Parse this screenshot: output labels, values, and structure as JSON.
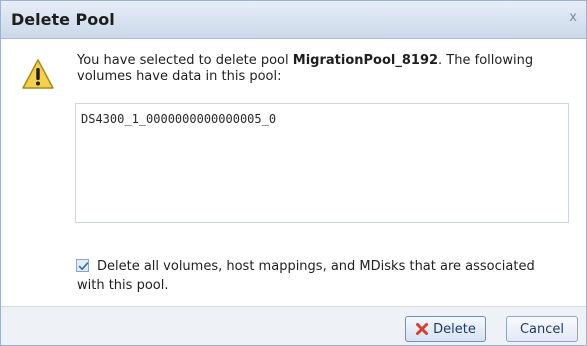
{
  "dialog": {
    "title": "Delete Pool",
    "close_glyph": "x"
  },
  "message": {
    "prefix": "You have selected to delete pool ",
    "pool_name": "MigrationPool_8192",
    "suffix": ". The following volumes have data in this pool:"
  },
  "volumes": [
    "DS4300_1_0000000000000005_0"
  ],
  "checkbox": {
    "checked": true,
    "label": "Delete all volumes, host mappings, and MDisks that are associated with this pool."
  },
  "buttons": {
    "delete_label": "Delete",
    "cancel_label": "Cancel"
  },
  "icons": {
    "warning": "warning-icon",
    "delete": "red-x-icon",
    "checkmark": "checkmark-icon"
  },
  "colors": {
    "titlebar": "#cbd8ea",
    "warning_fill": "#f5d04a",
    "delete_x": "#d9402b",
    "footer": "#eef2f7"
  }
}
